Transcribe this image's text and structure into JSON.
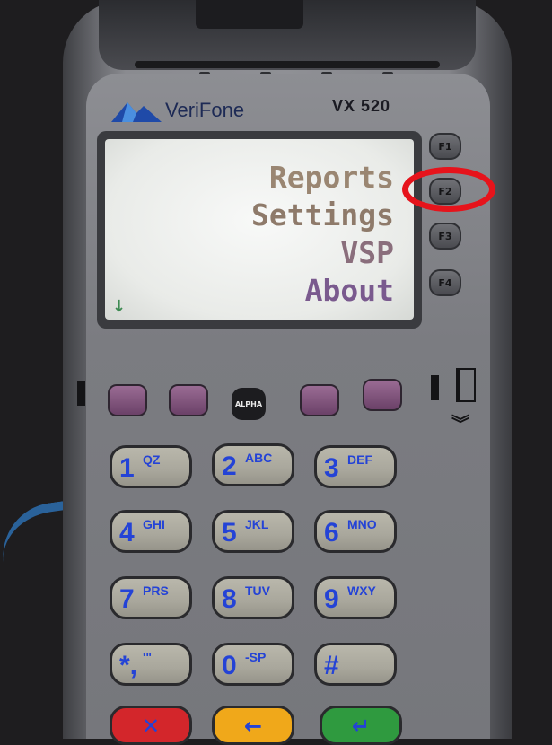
{
  "device": {
    "brand": "VeriFone",
    "model": "VX 520"
  },
  "screen": {
    "menu_items": [
      "Reports",
      "Settings",
      "VSP",
      "About"
    ],
    "scroll_indicator": "↓"
  },
  "function_keys": [
    "F1",
    "F2",
    "F3",
    "F4"
  ],
  "highlighted_key": "F2",
  "alpha_label": "ALPHA",
  "keypad": [
    {
      "main": "1",
      "sub": "QZ"
    },
    {
      "main": "2",
      "sub": "ABC"
    },
    {
      "main": "3",
      "sub": "DEF"
    },
    {
      "main": "4",
      "sub": "GHI"
    },
    {
      "main": "5",
      "sub": "JKL"
    },
    {
      "main": "6",
      "sub": "MNO"
    },
    {
      "main": "7",
      "sub": "PRS"
    },
    {
      "main": "8",
      "sub": "TUV"
    },
    {
      "main": "9",
      "sub": "WXY"
    },
    {
      "main": "*,",
      "sub": "'\""
    },
    {
      "main": "0",
      "sub": "-SP"
    },
    {
      "main": "#",
      "sub": ""
    }
  ],
  "bottom_keys": {
    "cancel": "✕",
    "clear": "←",
    "enter": "↵"
  },
  "colors": {
    "keypad_text": "#2443d6",
    "highlight_ring": "#e6131b",
    "soft_key": "#8a5a84",
    "cancel_key": "#d3262b",
    "clear_key": "#f0a81a",
    "enter_key": "#2f9a3f"
  }
}
